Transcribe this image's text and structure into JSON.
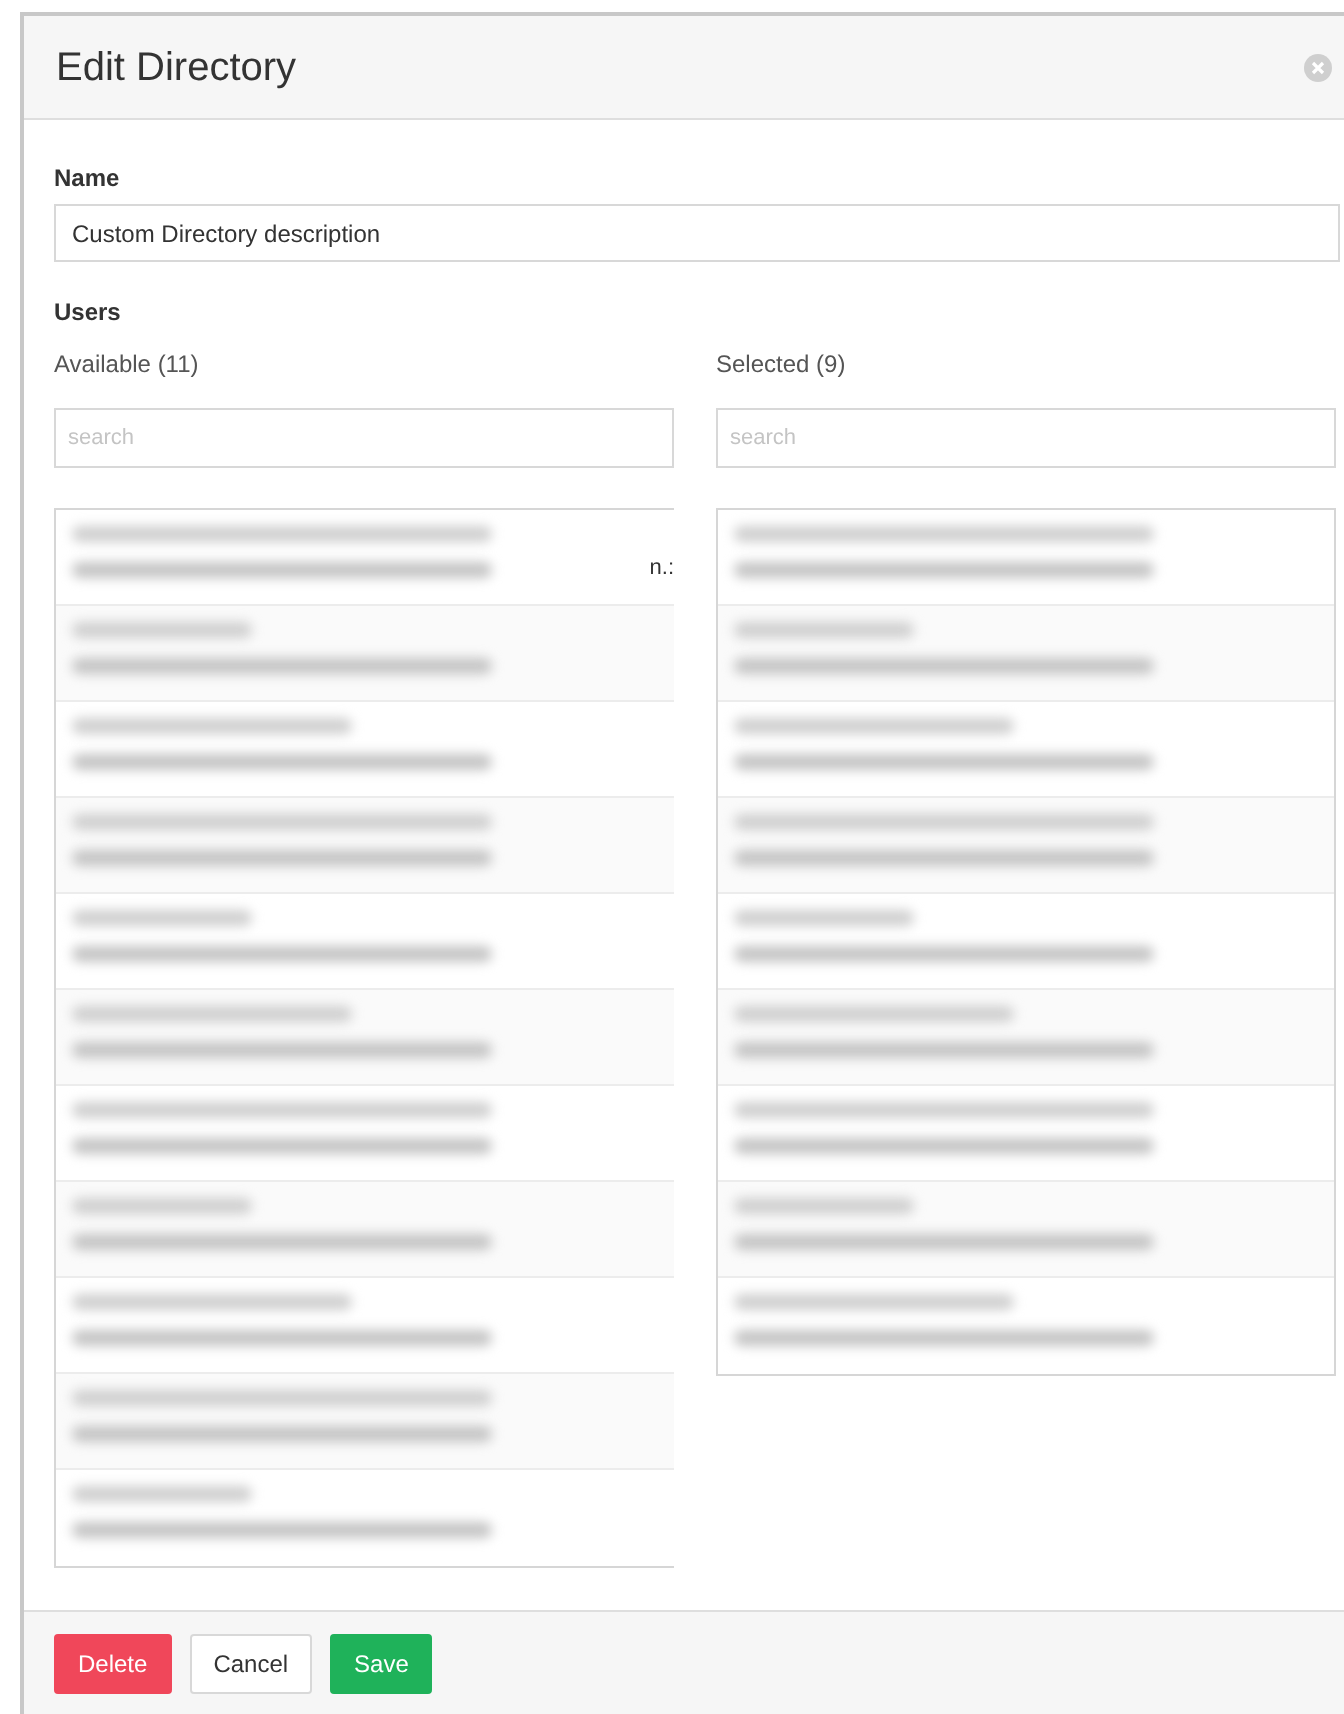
{
  "dialog": {
    "title": "Edit Directory"
  },
  "name_field": {
    "label": "Name",
    "value": "Custom Directory description"
  },
  "users": {
    "label": "Users",
    "available": {
      "label": "Available (11)",
      "search": {
        "placeholder": "search"
      },
      "items": [
        {
          "kind": "redacted",
          "text_fragment": "n.:"
        },
        {
          "kind": "redacted"
        },
        {
          "kind": "redacted"
        },
        {
          "kind": "redacted"
        },
        {
          "kind": "redacted"
        },
        {
          "kind": "redacted"
        },
        {
          "kind": "redacted"
        },
        {
          "kind": "redacted"
        },
        {
          "kind": "redacted"
        },
        {
          "kind": "redacted"
        },
        {
          "kind": "redacted"
        }
      ]
    },
    "selected": {
      "label": "Selected (9)",
      "search": {
        "placeholder": "search"
      },
      "items": [
        {
          "kind": "redacted"
        },
        {
          "kind": "redacted"
        },
        {
          "kind": "redacted"
        },
        {
          "kind": "redacted"
        },
        {
          "kind": "redacted"
        },
        {
          "kind": "redacted"
        },
        {
          "kind": "redacted"
        },
        {
          "kind": "redacted"
        },
        {
          "kind": "redacted"
        }
      ]
    }
  },
  "buttons": [
    {
      "label": "Delete",
      "kind": "danger"
    },
    {
      "label": "Cancel",
      "kind": "default"
    },
    {
      "label": "Save",
      "kind": "success"
    }
  ]
}
